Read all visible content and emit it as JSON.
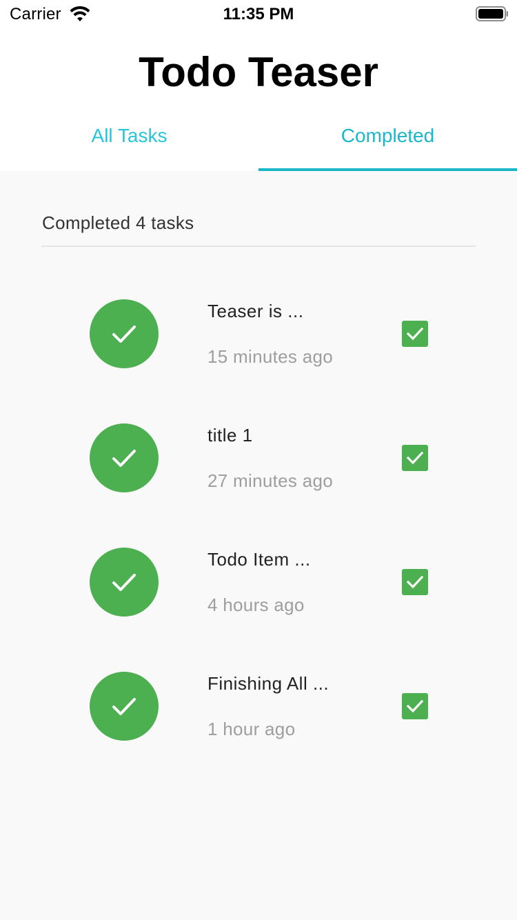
{
  "status_bar": {
    "carrier": "Carrier",
    "time": "11:35 PM",
    "wifi_icon": "wifi-icon",
    "battery_icon": "battery-full-icon"
  },
  "header": {
    "title": "Todo Teaser",
    "tabs": [
      {
        "label": "All Tasks",
        "active": false
      },
      {
        "label": "Completed",
        "active": true
      }
    ]
  },
  "content": {
    "summary": "Completed 4 tasks",
    "tasks": [
      {
        "title": "Teaser is ...",
        "time": "15 minutes ago",
        "completed": true
      },
      {
        "title": "title 1",
        "time": "27 minutes ago",
        "completed": true
      },
      {
        "title": "Todo Item ...",
        "time": "4 hours ago",
        "completed": true
      },
      {
        "title": "Finishing All ...",
        "time": "1 hour ago",
        "completed": true
      }
    ]
  },
  "colors": {
    "accent": "#1ab7c9",
    "accent_light": "#26c6da",
    "success": "#4caf50",
    "background": "#f9f9f9",
    "secondary_text": "#9e9e9e"
  }
}
